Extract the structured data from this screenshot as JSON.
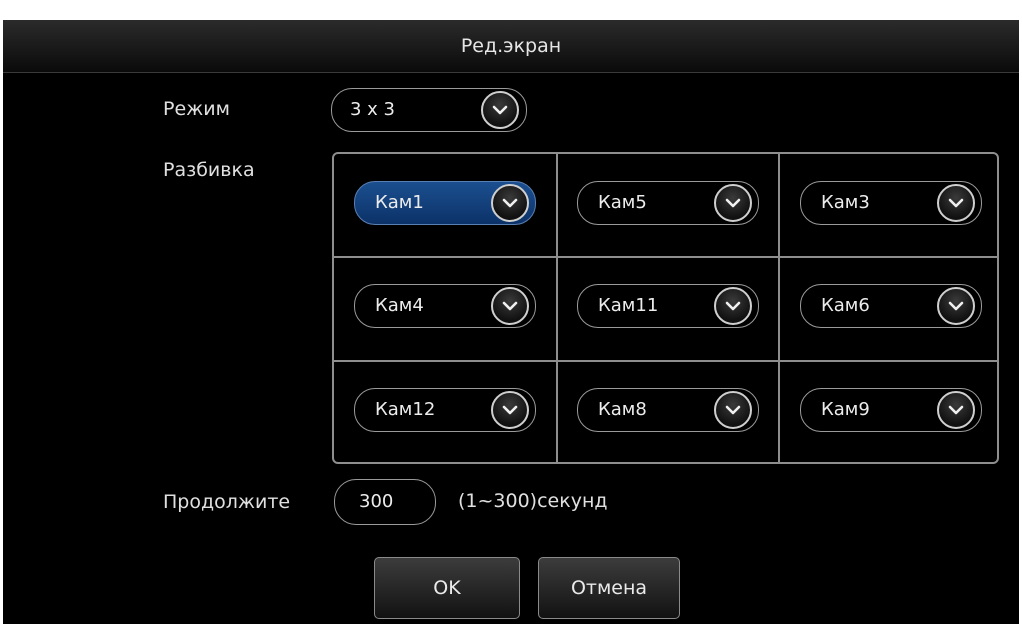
{
  "dialog": {
    "title": "Ред.экран"
  },
  "mode": {
    "label": "Режим",
    "value": "3 x 3"
  },
  "layout": {
    "label": "Разбивка",
    "cells": [
      {
        "value": "Кам1",
        "selected": true
      },
      {
        "value": "Кам5",
        "selected": false
      },
      {
        "value": "Кам3",
        "selected": false
      },
      {
        "value": "Кам4",
        "selected": false
      },
      {
        "value": "Кам11",
        "selected": false
      },
      {
        "value": "Кам6",
        "selected": false
      },
      {
        "value": "Кам12",
        "selected": false
      },
      {
        "value": "Кам8",
        "selected": false
      },
      {
        "value": "Кам9",
        "selected": false
      }
    ]
  },
  "duration": {
    "label": "Продолжите",
    "value": "300",
    "hint": "(1~300)секунд"
  },
  "buttons": {
    "ok": "OK",
    "cancel": "Отмена"
  },
  "colors": {
    "background": "#000000",
    "selected": "#0c3268",
    "border": "#9a9a9a",
    "text": "#e6e6e6"
  },
  "icons": {
    "dropdown": "chevron-down-icon"
  }
}
